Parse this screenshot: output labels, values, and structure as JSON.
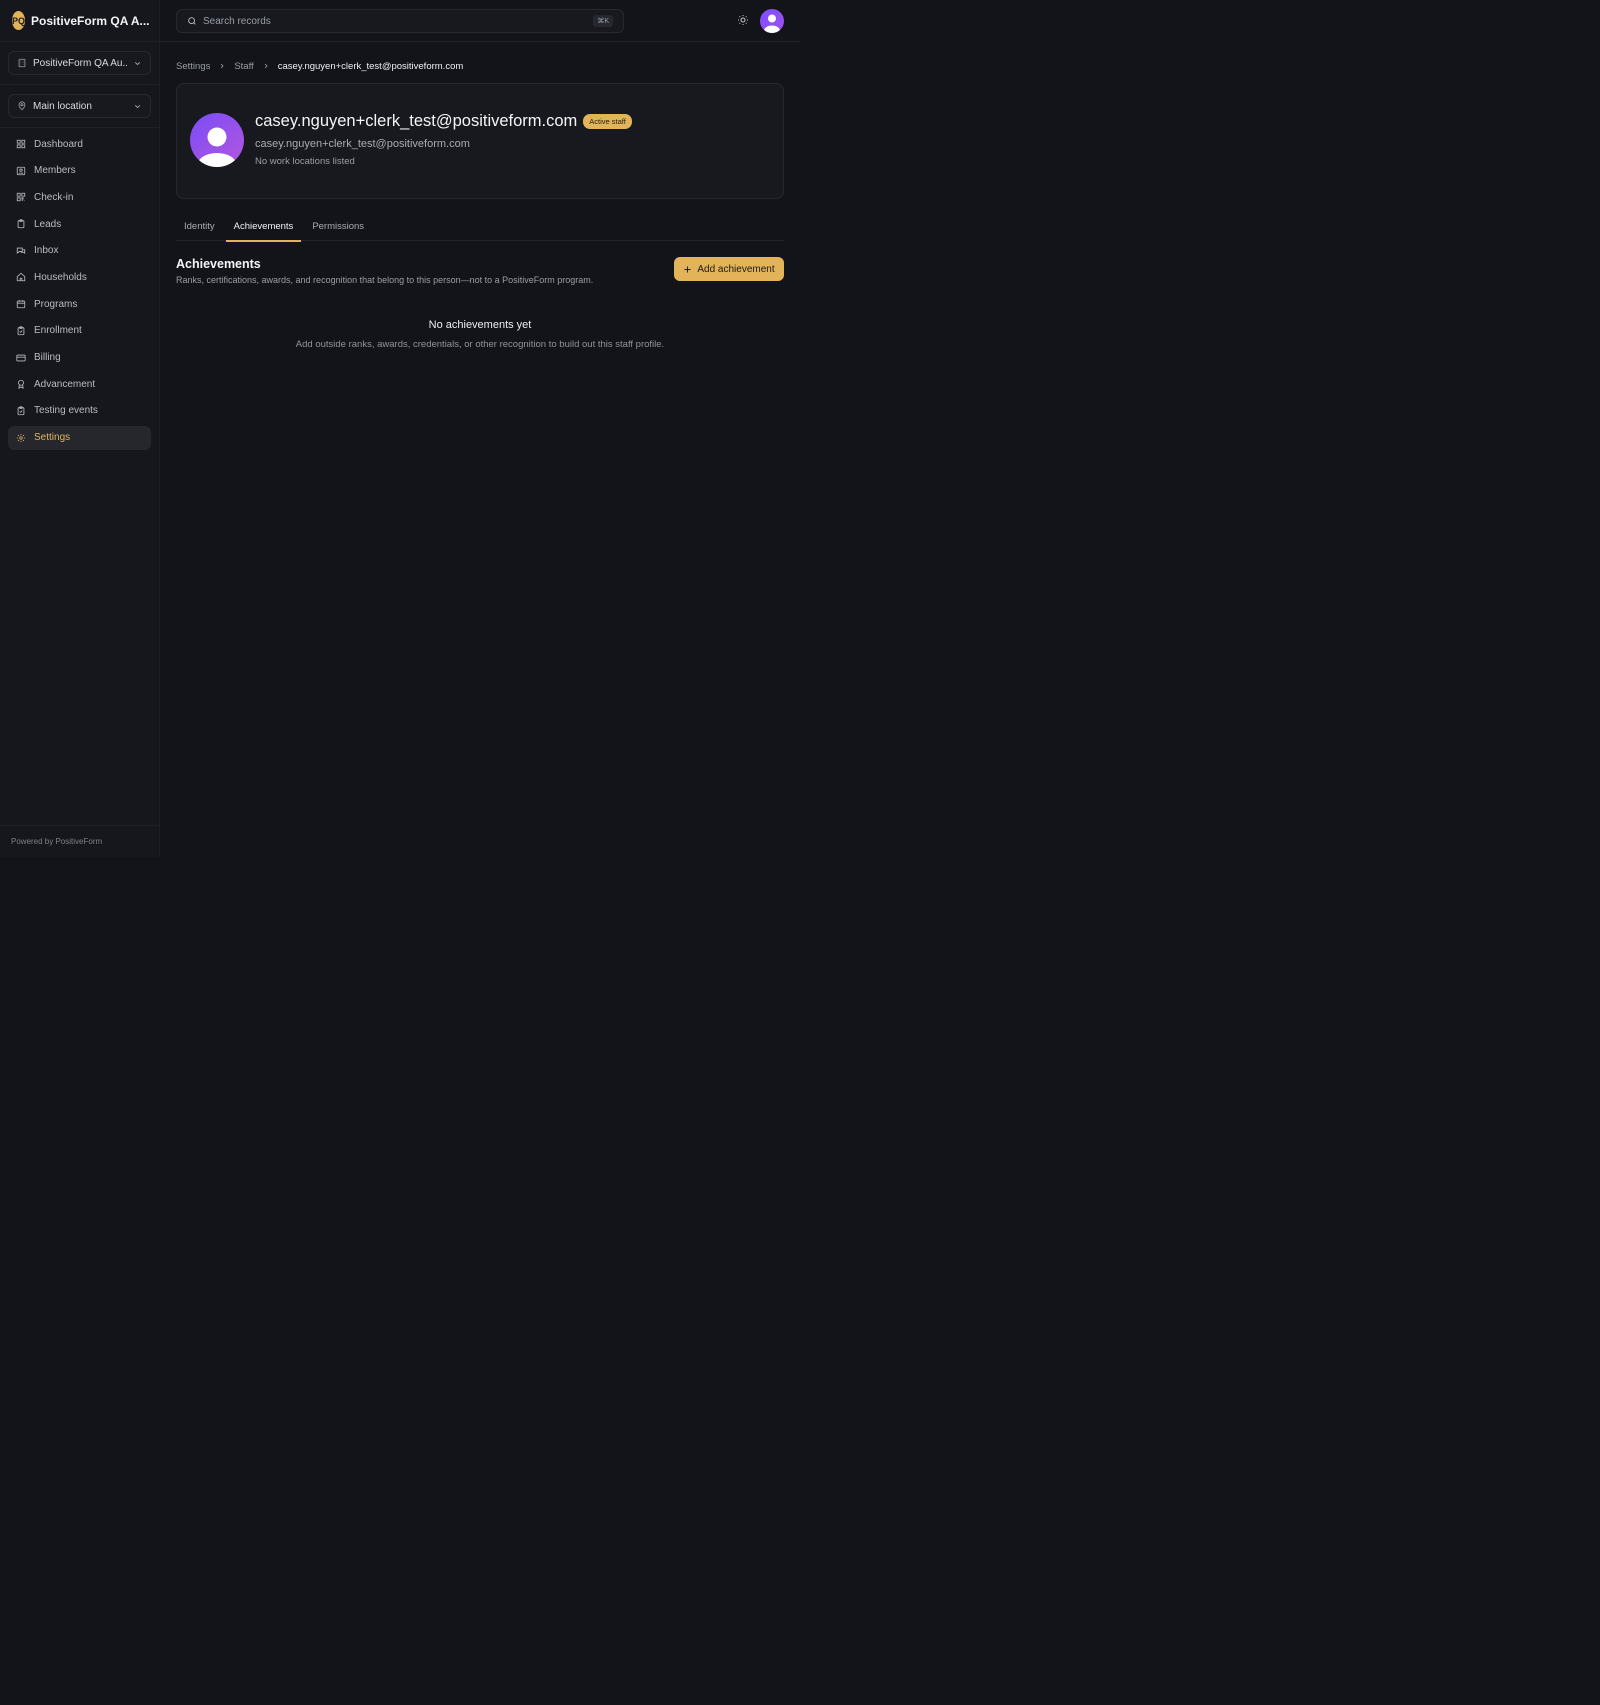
{
  "brand": {
    "badge": "PQ",
    "name": "PositiveForm QA A..."
  },
  "selectors": {
    "org": {
      "label": "PositiveForm QA Au...",
      "icon": "building-icon"
    },
    "location": {
      "label": "Main location",
      "icon": "map-pin-icon"
    }
  },
  "sidebar": {
    "items": [
      {
        "label": "Dashboard",
        "icon": "dashboard-icon"
      },
      {
        "label": "Members",
        "icon": "members-icon"
      },
      {
        "label": "Check-in",
        "icon": "qr-code-icon"
      },
      {
        "label": "Leads",
        "icon": "clipboard-icon"
      },
      {
        "label": "Inbox",
        "icon": "chat-icon"
      },
      {
        "label": "Households",
        "icon": "home-icon"
      },
      {
        "label": "Programs",
        "icon": "calendar-icon"
      },
      {
        "label": "Enrollment",
        "icon": "clipboard-check-icon"
      },
      {
        "label": "Billing",
        "icon": "credit-card-icon"
      },
      {
        "label": "Advancement",
        "icon": "award-icon"
      },
      {
        "label": "Testing events",
        "icon": "clipboard-list-icon"
      },
      {
        "label": "Settings",
        "icon": "gear-icon",
        "active": true
      }
    ],
    "footer": "Powered by PositiveForm"
  },
  "topbar": {
    "search_placeholder": "Search records",
    "shortcut": "⌘K"
  },
  "breadcrumb": [
    "Settings",
    "Staff",
    "casey.nguyen+clerk_test@positiveform.com"
  ],
  "profile": {
    "name": "casey.nguyen+clerk_test@positiveform.com",
    "status_badge": "Active staff",
    "email": "casey.nguyen+clerk_test@positiveform.com",
    "locations": "No work locations listed"
  },
  "tabs": [
    {
      "label": "Identity"
    },
    {
      "label": "Achievements",
      "active": true
    },
    {
      "label": "Permissions"
    }
  ],
  "achievements": {
    "title": "Achievements",
    "subtitle": "Ranks, certifications, awards, and recognition that belong to this person—not to a PositiveForm program.",
    "add_button": "Add achievement",
    "empty_title": "No achievements yet",
    "empty_subtitle": "Add outside ranks, awards, credentials, or other recognition to build out this staff profile."
  },
  "colors": {
    "accent": "#e3b35a",
    "background": "#121419",
    "avatar": "#7c4dff"
  }
}
